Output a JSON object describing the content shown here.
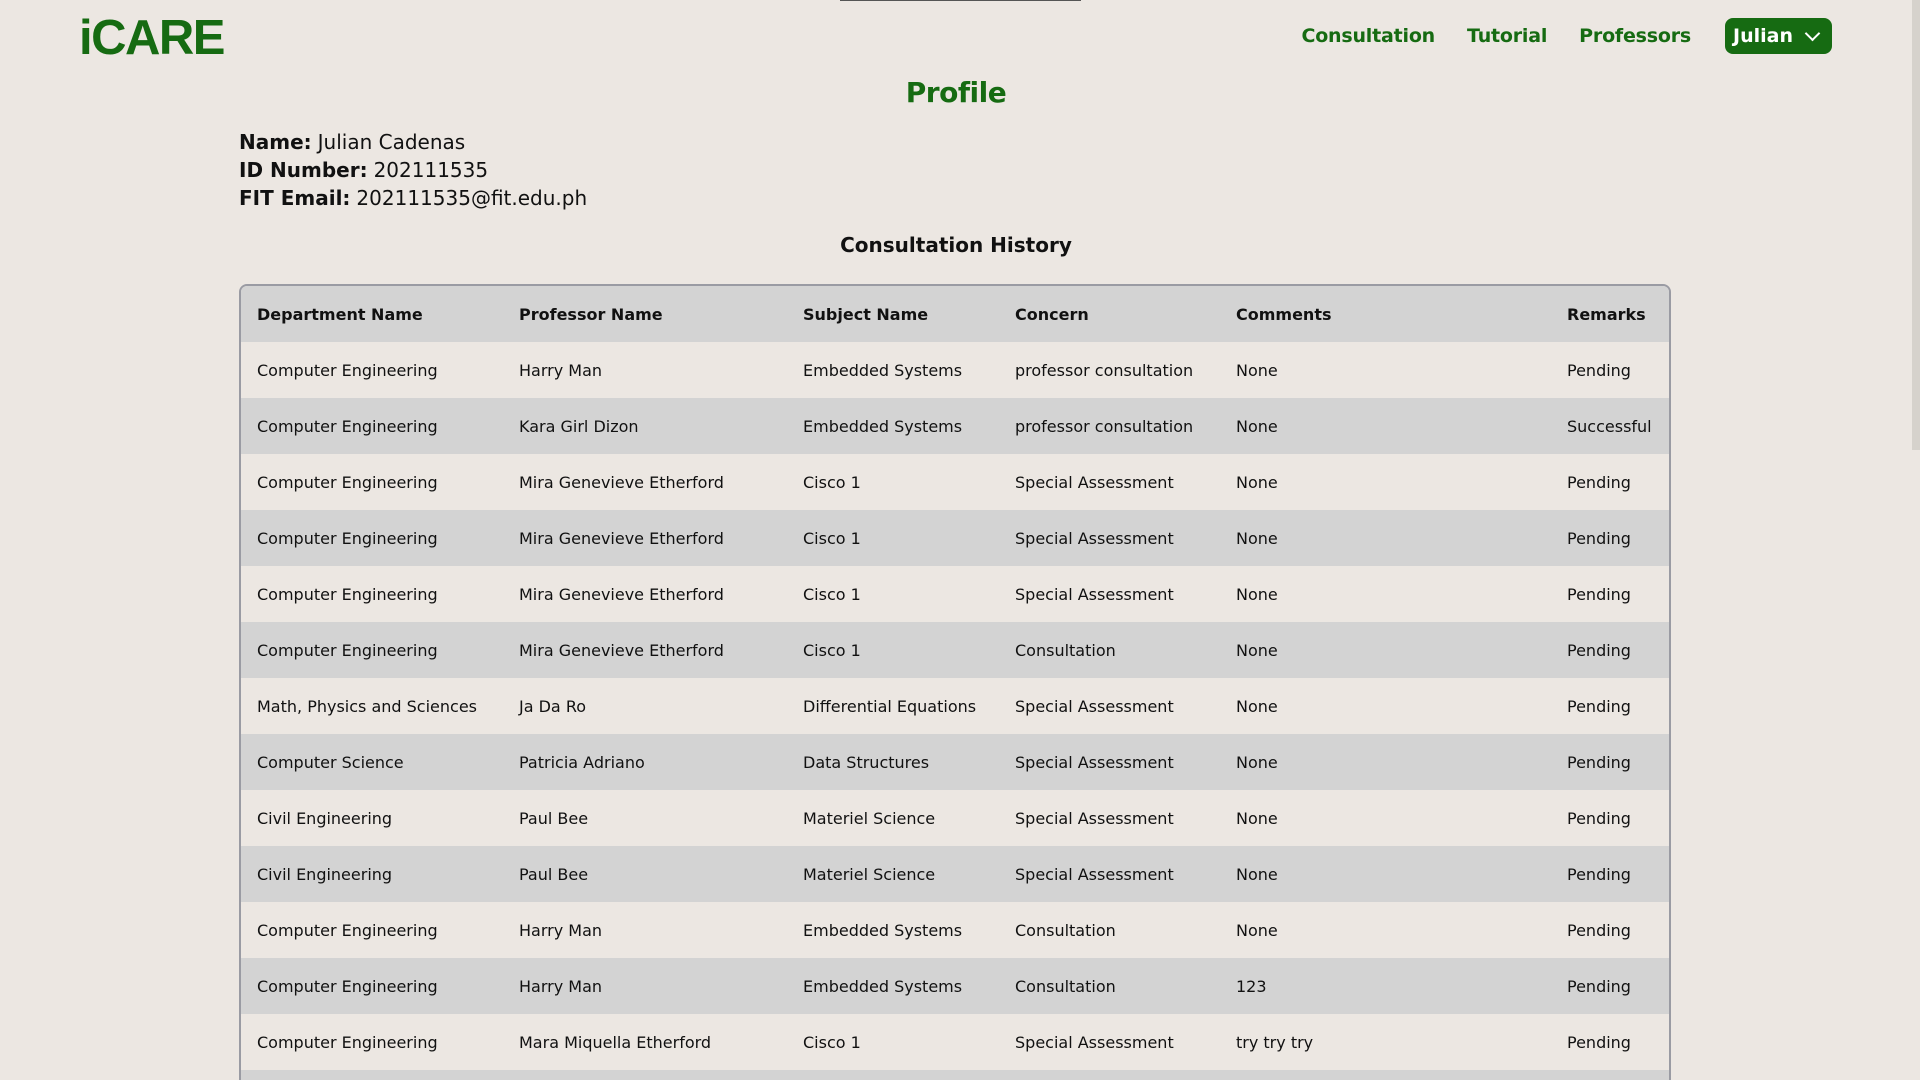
{
  "header": {
    "logo": "iCARE",
    "nav": [
      "Consultation",
      "Tutorial",
      "Professors"
    ],
    "user": "Julian"
  },
  "profile": {
    "title": "Profile",
    "name_label": "Name:",
    "name": "Julian Cadenas",
    "id_label": "ID Number:",
    "id": "202111535",
    "email_label": "FIT Email:",
    "email": "202111535@fit.edu.ph"
  },
  "history": {
    "title": "Consultation History",
    "columns": [
      "Department Name",
      "Professor Name",
      "Subject Name",
      "Concern",
      "Comments",
      "Remarks"
    ],
    "rows": [
      [
        "Computer Engineering",
        "Harry Man",
        "Embedded Systems",
        "professor consultation",
        "None",
        "Pending"
      ],
      [
        "Computer Engineering",
        "Kara Girl Dizon",
        "Embedded Systems",
        "professor consultation",
        "None",
        "Successful"
      ],
      [
        "Computer Engineering",
        "Mira Genevieve Etherford",
        "Cisco 1",
        "Special Assessment",
        "None",
        "Pending"
      ],
      [
        "Computer Engineering",
        "Mira Genevieve Etherford",
        "Cisco 1",
        "Special Assessment",
        "None",
        "Pending"
      ],
      [
        "Computer Engineering",
        "Mira Genevieve Etherford",
        "Cisco 1",
        "Special Assessment",
        "None",
        "Pending"
      ],
      [
        "Computer Engineering",
        "Mira Genevieve Etherford",
        "Cisco 1",
        "Consultation",
        "None",
        "Pending"
      ],
      [
        "Math, Physics and Sciences",
        "Ja Da Ro",
        "Differential Equations",
        "Special Assessment",
        "None",
        "Pending"
      ],
      [
        "Computer Science",
        "Patricia Adriano",
        "Data Structures",
        "Special Assessment",
        "None",
        "Pending"
      ],
      [
        "Civil Engineering",
        "Paul Bee",
        "Materiel Science",
        "Special Assessment",
        "None",
        "Pending"
      ],
      [
        "Civil Engineering",
        "Paul Bee",
        "Materiel Science",
        "Special Assessment",
        "None",
        "Pending"
      ],
      [
        "Computer Engineering",
        "Harry Man",
        "Embedded Systems",
        "Consultation",
        "None",
        "Pending"
      ],
      [
        "Computer Engineering",
        "Harry Man",
        "Embedded Systems",
        "Consultation",
        "123",
        "Pending"
      ],
      [
        "Computer Engineering",
        "Mara Miquella Etherford",
        "Cisco 1",
        "Special Assessment",
        "try try try",
        "Pending"
      ],
      [
        "",
        "",
        "",
        "",
        "",
        ""
      ]
    ]
  },
  "colors": {
    "brand_green": "#166b12",
    "background": "#ece7e2",
    "row_alt": "#d3d3d3"
  }
}
